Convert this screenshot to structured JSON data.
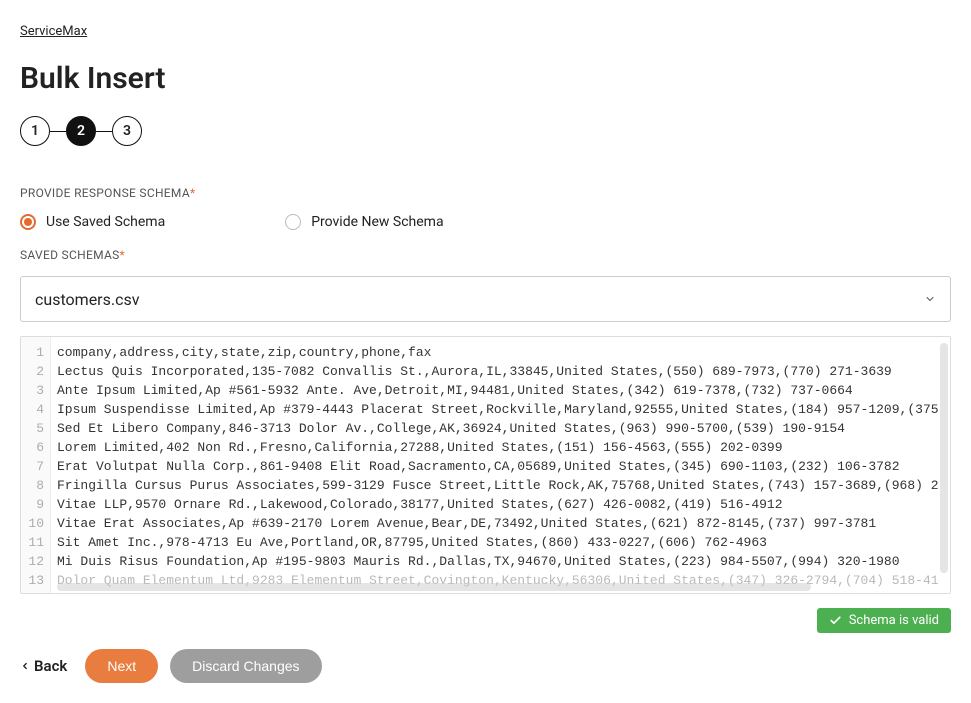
{
  "breadcrumb": "ServiceMax",
  "page_title": "Bulk Insert",
  "stepper": {
    "steps": [
      "1",
      "2",
      "3"
    ],
    "active_index": 1
  },
  "schema_section": {
    "label": "PROVIDE RESPONSE SCHEMA",
    "required_mark": "*",
    "options": {
      "saved": "Use Saved Schema",
      "new": "Provide New Schema"
    },
    "selected": "saved"
  },
  "saved_schemas": {
    "label": "SAVED SCHEMAS",
    "required_mark": "*",
    "selected": "customers.csv"
  },
  "editor": {
    "lines": [
      "company,address,city,state,zip,country,phone,fax",
      "Lectus Quis Incorporated,135-7082 Convallis St.,Aurora,IL,33845,United States,(550) 689-7973,(770) 271-3639",
      "Ante Ipsum Limited,Ap #561-5932 Ante. Ave,Detroit,MI,94481,United States,(342) 619-7378,(732) 737-0664",
      "Ipsum Suspendisse Limited,Ap #379-4443 Placerat Street,Rockville,Maryland,92555,United States,(184) 957-1209,(375",
      "Sed Et Libero Company,846-3713 Dolor Av.,College,AK,36924,United States,(963) 990-5700,(539) 190-9154",
      "Lorem Limited,402 Non Rd.,Fresno,California,27288,United States,(151) 156-4563,(555) 202-0399",
      "Erat Volutpat Nulla Corp.,861-9408 Elit Road,Sacramento,CA,05689,United States,(345) 690-1103,(232) 106-3782",
      "Fringilla Cursus Purus Associates,599-3129 Fusce Street,Little Rock,AK,75768,United States,(743) 157-3689,(968) 2",
      "Vitae LLP,9570 Ornare Rd.,Lakewood,Colorado,38177,United States,(627) 426-0082,(419) 516-4912",
      "Vitae Erat Associates,Ap #639-2170 Lorem Avenue,Bear,DE,73492,United States,(621) 872-8145,(737) 997-3781",
      "Sit Amet Inc.,978-4713 Eu Ave,Portland,OR,87795,United States,(860) 433-0227,(606) 762-4963",
      "Mi Duis Risus Foundation,Ap #195-9803 Mauris Rd.,Dallas,TX,94670,United States,(223) 984-5507,(994) 320-1980",
      "Dolor Quam Elementum Ltd,9283 Elementum Street,Covington,Kentucky,56306,United States,(347) 326-2794,(704) 518-41"
    ]
  },
  "status": {
    "valid_text": "Schema is valid"
  },
  "footer": {
    "back": "Back",
    "next": "Next",
    "discard": "Discard Changes"
  }
}
